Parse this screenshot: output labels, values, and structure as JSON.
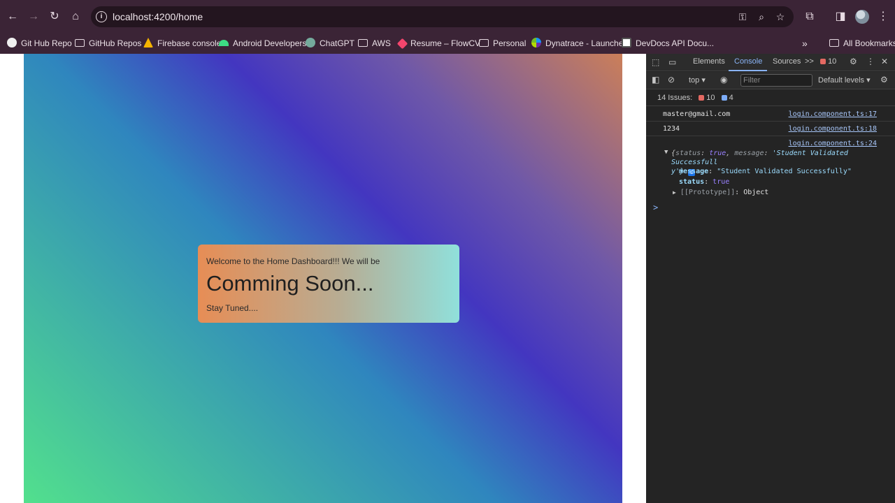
{
  "browser": {
    "url": "localhost:4200/home",
    "bookmarks": [
      {
        "label": "Git Hub Repo",
        "icon": "github-icon"
      },
      {
        "label": "GitHub Repos",
        "icon": "folder-icon"
      },
      {
        "label": "Firebase console",
        "icon": "firebase-icon"
      },
      {
        "label": "Android Developers",
        "icon": "android-icon"
      },
      {
        "label": "ChatGPT",
        "icon": "chatgpt-icon"
      },
      {
        "label": "AWS",
        "icon": "folder-icon"
      },
      {
        "label": "Resume – FlowCV",
        "icon": "flowcv-icon"
      },
      {
        "label": "Personal",
        "icon": "folder-icon"
      },
      {
        "label": "Dynatrace - Launcher",
        "icon": "dynatrace-icon"
      },
      {
        "label": "DevDocs API Docu...",
        "icon": "devdocs-icon"
      }
    ],
    "more_label": "»",
    "all_bookmarks": "All Bookmarks"
  },
  "page": {
    "welcome": "Welcome to the Home Dashboard!!! We will be",
    "headline": "Comming Soon...",
    "stay": "Stay Tuned...."
  },
  "devtools": {
    "tabs": [
      "Elements",
      "Console",
      "Sources"
    ],
    "active_tab": "Console",
    "more_tabs": ">>",
    "error_count": "10",
    "context": "top",
    "filter_placeholder": "Filter",
    "levels": "Default levels",
    "issues_label": "14 Issues:",
    "issues_errors": "10",
    "issues_info": "4",
    "logs": [
      {
        "text": "master@gmail.com",
        "source": "login.component.ts:17"
      },
      {
        "text": "1234",
        "source": "login.component.ts:18"
      }
    ],
    "object_log": {
      "source": "login.component.ts:24",
      "summary_open": "{",
      "summary_status_key": "status",
      "summary_status_val": "true",
      "summary_msg_key": "message",
      "summary_msg_val": "'Student Validated Successfull",
      "summary_tail": "y'}",
      "message_key": "message",
      "message_val": "\"Student Validated Successfully\"",
      "status_key": "status",
      "status_val": "true",
      "proto_key": "[[Prototype]]",
      "proto_val": "Object"
    },
    "prompt": ">"
  },
  "colors": {
    "frame": "#3b2436",
    "devtools_bg": "#242424",
    "link": "#a8c7fa"
  }
}
